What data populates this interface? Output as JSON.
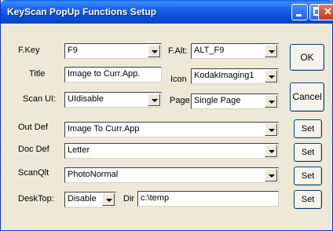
{
  "window": {
    "title": "KeyScan PopUp Functions Setup"
  },
  "fkey": {
    "label": "F.Key",
    "value": "F9"
  },
  "falt": {
    "label": "F.Alt:",
    "value": "ALT_F9"
  },
  "title_field": {
    "label": "Title",
    "value": "Image to Curr.App."
  },
  "icon": {
    "label": "Icon",
    "value": "KodakImaging1"
  },
  "scan_ui": {
    "label": "Scan UI:",
    "value": "UIdisable"
  },
  "page": {
    "label": "Page",
    "value": "Single Page"
  },
  "out_def": {
    "label": "Out Def",
    "value": "Image To Curr.App",
    "set_label": "Set"
  },
  "doc_def": {
    "label": "Doc Def",
    "value": "Letter",
    "set_label": "Set"
  },
  "scan_qlt": {
    "label": "ScanQlt",
    "value": "PhotoNormal",
    "set_label": "Set"
  },
  "desktop": {
    "label": "DeskTop:",
    "value": "Disable"
  },
  "dir": {
    "label": "Dir",
    "value": "c:\\temp",
    "set_label": "Set"
  },
  "buttons": {
    "ok": "OK",
    "cancel": "Cancel"
  }
}
